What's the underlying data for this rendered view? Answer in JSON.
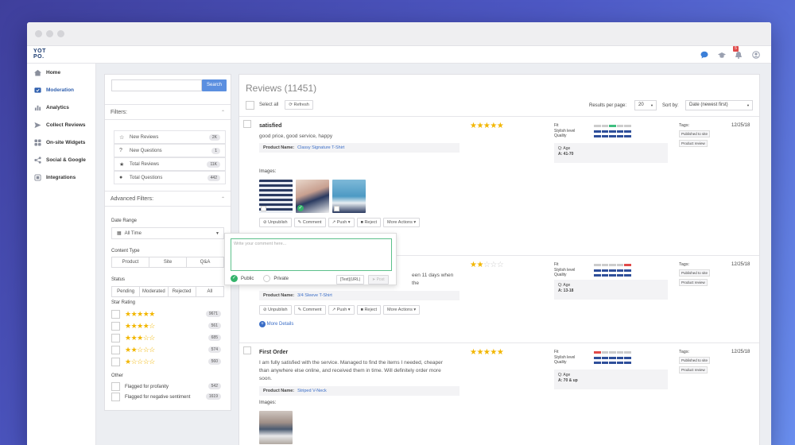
{
  "sidebar": {
    "items": [
      {
        "label": "Home"
      },
      {
        "label": "Moderation"
      },
      {
        "label": "Analytics"
      },
      {
        "label": "Collect Reviews"
      },
      {
        "label": "On-site Widgets"
      },
      {
        "label": "Social & Google"
      },
      {
        "label": "Integrations"
      }
    ]
  },
  "logo": {
    "line1": "YOT",
    "line2": "PO."
  },
  "topbar": {
    "notif_count": "5"
  },
  "search": {
    "placeholder": "",
    "button": "Search"
  },
  "filters": {
    "title": "Filters:",
    "rows": [
      {
        "label": "New Reviews",
        "count": "2K"
      },
      {
        "label": "New Questions",
        "count": "1"
      },
      {
        "label": "Total Reviews",
        "count": "11K"
      },
      {
        "label": "Total Questions",
        "count": "442"
      }
    ]
  },
  "advanced": {
    "title": "Advanced Filters:",
    "date_label": "Date Range",
    "date_value": "All Time",
    "content_label": "Content Type",
    "content_opts": [
      "Product",
      "Site",
      "Q&A"
    ],
    "status_label": "Status",
    "status_opts": [
      "Pending",
      "Moderated",
      "Rejected",
      "All"
    ],
    "rating_label": "Star Rating",
    "ratings": [
      {
        "stars": 5,
        "count": "9671"
      },
      {
        "stars": 4,
        "count": "561"
      },
      {
        "stars": 3,
        "count": "685"
      },
      {
        "stars": 2,
        "count": "574"
      },
      {
        "stars": 1,
        "count": "560"
      }
    ],
    "other_label": "Other",
    "other": [
      {
        "label": "Flagged for profanity",
        "count": "542"
      },
      {
        "label": "Flagged for negative sentiment",
        "count": "1619"
      }
    ]
  },
  "reviews_header": {
    "title": "Reviews (11451)",
    "select_all": "Select all",
    "refresh": "Refresh",
    "per_page_label": "Results per page:",
    "per_page": "20",
    "sort_label": "Sort by:",
    "sort": "Date (newest first)"
  },
  "labels": {
    "product_name": "Product Name:",
    "images": "Images:",
    "tags": "Tags:",
    "fit": "Fit",
    "stylish": "Stylish level",
    "quality": "Quality",
    "unpublish": "Unpublish",
    "comment": "Comment",
    "push": "Push",
    "reject": "Reject",
    "more_actions": "More Actions",
    "more_details": "More Details"
  },
  "reviews": [
    {
      "title": "satisfied",
      "text": "good price, good service, happy",
      "product": "Classy Signature T-Shirt",
      "stars": 5,
      "q": "Q: Age",
      "a": "A: 41-70",
      "date": "12/25/18",
      "tags": [
        "Published to site",
        "Product review"
      ]
    },
    {
      "title": "",
      "text": "een 11 days when the",
      "product": "3/4 Sleeve T-Shirt",
      "stars": 2,
      "q": "Q: Age",
      "a": "A: 13-18",
      "date": "12/25/18",
      "tags": [
        "Published to site",
        "Product review"
      ]
    },
    {
      "title": "First Order",
      "text": "I am fully satisfied with the service. Managed to find the items I needed, cheaper than anywhere else online, and received them in time. Will definitely order more soon.",
      "product": "Striped V-Neck",
      "stars": 5,
      "q": "Q: Age",
      "a": "A: 70 & up",
      "date": "12/25/18",
      "tags": [
        "Published to site",
        "Product review"
      ]
    }
  ],
  "popup": {
    "placeholder": "Write your comment here...",
    "public": "Public",
    "private": "Private",
    "text_url": "[Text](URL)",
    "post": "Post"
  },
  "colors": {
    "accent": "#2f5fae",
    "star": "#f2b600",
    "button": "#5b8fe0"
  }
}
